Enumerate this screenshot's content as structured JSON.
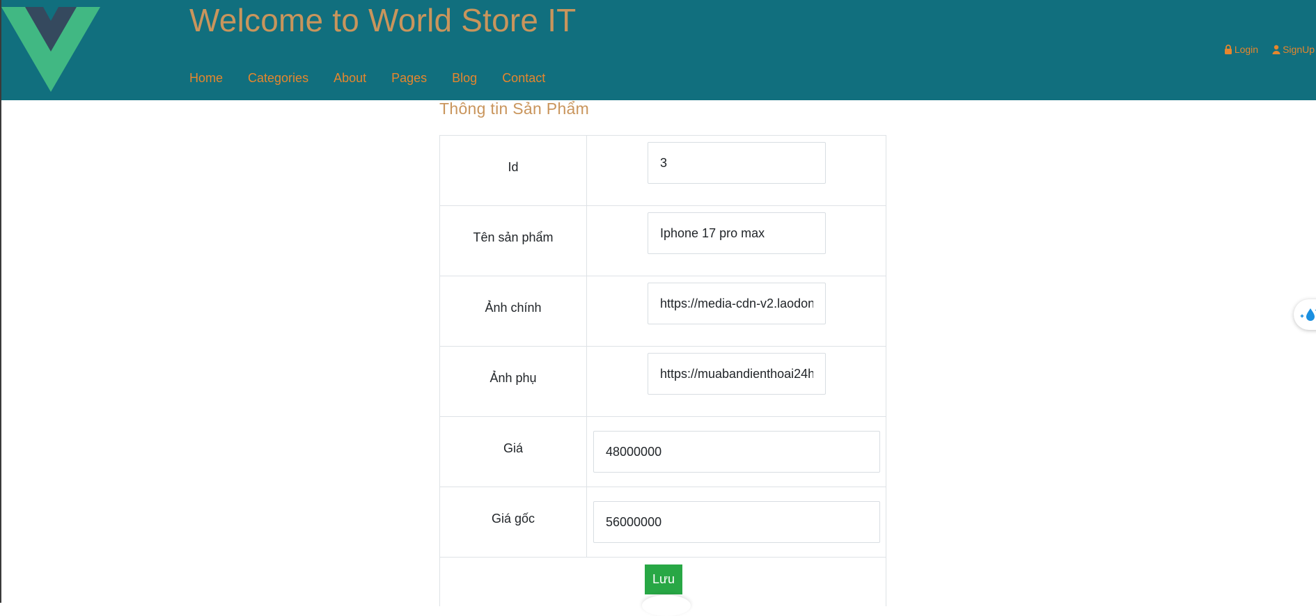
{
  "header": {
    "title": "Welcome to World Store IT",
    "nav": [
      "Home",
      "Categories",
      "About",
      "Pages",
      "Blog",
      "Contact"
    ],
    "auth": {
      "login_label": "Login",
      "signup_label": "SignUp"
    }
  },
  "colors": {
    "header_bg": "#116f7e",
    "title": "#c9955c",
    "nav_link": "#e6862d",
    "save_button": "#28a745",
    "logo_green": "#41b883",
    "logo_dark": "#35495e"
  },
  "form": {
    "section_title": "Thông tin Sản Phẩm",
    "rows": [
      {
        "label": "Id",
        "value": "3"
      },
      {
        "label": "Tên sản phẩm",
        "value": "Iphone 17 pro max"
      },
      {
        "label": "Ảnh chính",
        "value": "https://media-cdn-v2.laodon"
      },
      {
        "label": "Ảnh phụ",
        "value": "https://muabandienthoai24h"
      },
      {
        "label": "Giá",
        "value": "48000000"
      },
      {
        "label": "Giá gốc",
        "value": "56000000"
      }
    ],
    "save_label": "Lưu"
  },
  "icons": {
    "logo": "vue-logo",
    "login": "lock-icon",
    "signup": "user-icon",
    "widget": "water-drop-sparkle-icon"
  }
}
